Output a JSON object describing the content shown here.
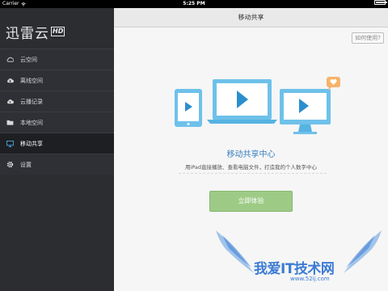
{
  "status_bar": {
    "carrier": "Carrier",
    "time": "5:25 PM"
  },
  "sidebar": {
    "logo_text": "迅雷云",
    "logo_badge": "HD",
    "items": [
      {
        "label": "云空间",
        "icon": "cloud-icon"
      },
      {
        "label": "离线空间",
        "icon": "cloud-download-icon"
      },
      {
        "label": "云播记录",
        "icon": "cloud-play-icon"
      },
      {
        "label": "本地空间",
        "icon": "folder-icon"
      },
      {
        "label": "移动共享",
        "icon": "monitor-icon",
        "active": true
      },
      {
        "label": "设置",
        "icon": "gear-icon"
      }
    ]
  },
  "main": {
    "title": "移动共享",
    "help_label": "如何使用?",
    "center_title": "移动共享中心",
    "center_desc": "用iPad直接播放、查看电脑文件，打造我的个人数字中心",
    "cta_label": "立即体验"
  },
  "watermark": {
    "text": "我爱IT技术网",
    "url": "www.52ij.com"
  },
  "colors": {
    "sidebar_bg": "#2b2d31",
    "accent_blue": "#3a7fc0",
    "button_green": "#9dcb86",
    "illustration_blue": "#6ec1ea"
  }
}
